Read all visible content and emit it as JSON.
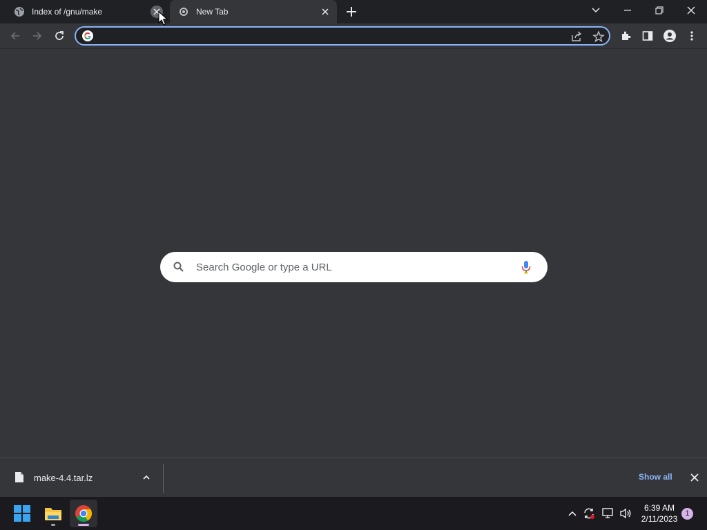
{
  "browser": {
    "tabs": [
      {
        "title": "Index of /gnu/make",
        "favicon": "globe-icon",
        "active": false
      },
      {
        "title": "New Tab",
        "favicon": "chrome-icon",
        "active": true
      }
    ],
    "omnibox": {
      "value": "",
      "placeholder": ""
    }
  },
  "ntp": {
    "search_placeholder": "Search Google or type a URL"
  },
  "downloads": {
    "items": [
      {
        "filename": "make-4.4.tar.lz"
      }
    ],
    "show_all_label": "Show all"
  },
  "taskbar": {
    "time": "6:39 AM",
    "date": "2/11/2023",
    "notification_count": "1"
  },
  "colors": {
    "accent": "#8ab4f8",
    "frame": "#202124",
    "toolbar": "#35363a"
  }
}
